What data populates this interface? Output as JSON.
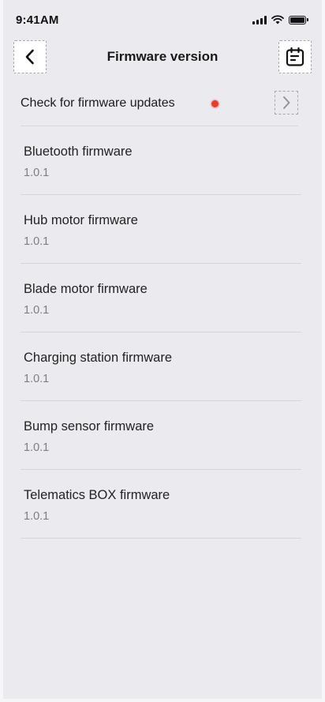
{
  "status_bar": {
    "time": "9:41AM"
  },
  "header": {
    "title": "Firmware version"
  },
  "check_updates": {
    "label": "Check for firmware updates",
    "has_update_indicator_color": "#ea3b2b"
  },
  "firmware_items": [
    {
      "name": "Bluetooth firmware",
      "version": "1.0.1"
    },
    {
      "name": "Hub motor firmware",
      "version": "1.0.1"
    },
    {
      "name": "Blade motor firmware",
      "version": "1.0.1"
    },
    {
      "name": "Charging station firmware",
      "version": "1.0.1"
    },
    {
      "name": "Bump sensor firmware",
      "version": "1.0.1"
    },
    {
      "name": "Telematics BOX firmware",
      "version": "1.0.1"
    }
  ],
  "icons": {
    "back": "chevron-left-icon",
    "calendar": "calendar-notes-icon",
    "forward": "chevron-right-icon"
  }
}
